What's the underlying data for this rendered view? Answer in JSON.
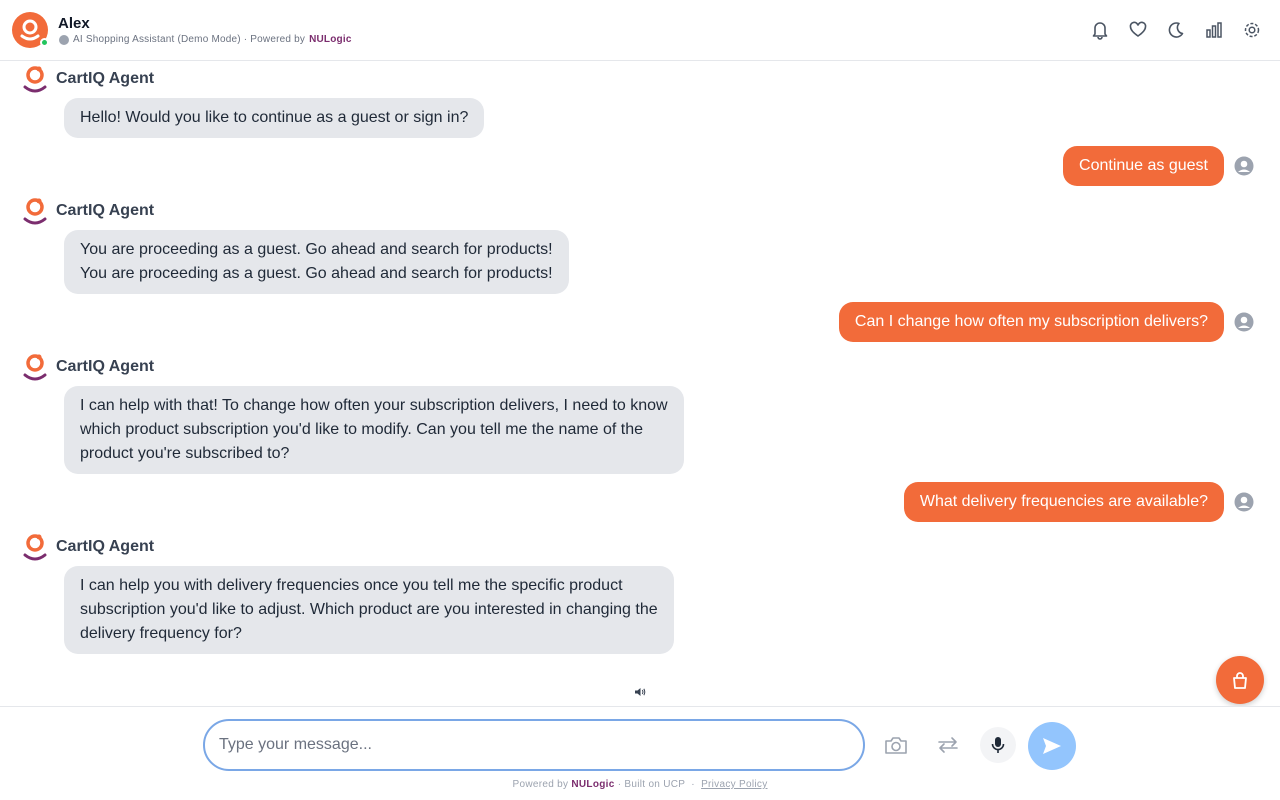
{
  "header": {
    "user_name": "Alex",
    "subtitle_prefix": "AI Shopping Assistant (Demo Mode) · Powered by",
    "brand": "NULogic",
    "icons": [
      "bell-icon",
      "heart-icon",
      "moon-icon",
      "chart-icon",
      "gear-icon"
    ]
  },
  "messages": [
    {
      "role": "agent",
      "sender": "CartIQ Agent",
      "lines": [
        "Hello! Would you like to continue as a guest or sign in?"
      ]
    },
    {
      "role": "user",
      "text": "Continue as guest"
    },
    {
      "role": "agent",
      "sender": "CartIQ Agent",
      "lines": [
        "You are proceeding as a guest. Go ahead and search for products!",
        "You are proceeding as a guest. Go ahead and search for products!"
      ]
    },
    {
      "role": "user",
      "text": "Can I change how often my subscription delivers?"
    },
    {
      "role": "agent",
      "sender": "CartIQ Agent",
      "lines": [
        "I can help with that! To change how often your subscription delivers, I need to know",
        "which product subscription you'd like to modify. Can you tell me the name of the",
        "product you're subscribed to?"
      ]
    },
    {
      "role": "user",
      "text": "What delivery frequencies are available?"
    },
    {
      "role": "agent",
      "sender": "CartIQ Agent",
      "lines": [
        "I can help you with delivery frequencies once you tell me the specific product",
        "subscription you'd like to adjust. Which product are you interested in changing the",
        "delivery frequency for?"
      ]
    }
  ],
  "composer": {
    "placeholder": "Type your message...",
    "icons": [
      "camera-icon",
      "swap-icon",
      "microphone-icon",
      "send-icon"
    ]
  },
  "footer": {
    "powered_prefix": "Powered by",
    "brand": "NULogic",
    "built": "· Built on UCP",
    "separator": "·",
    "privacy": "Privacy Policy"
  },
  "colors": {
    "accent": "#f26b3a",
    "brand": "#7b2d6e",
    "agent_bubble": "#e5e7eb",
    "send_button": "#93c5fd"
  }
}
